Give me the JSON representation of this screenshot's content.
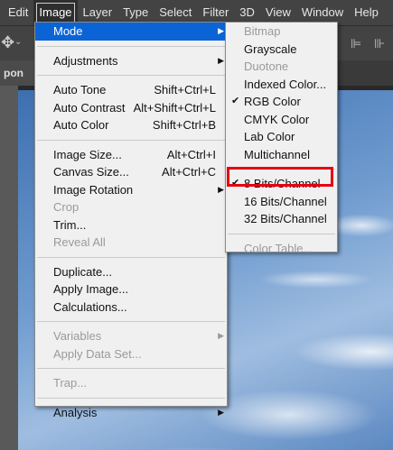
{
  "menubar": {
    "items": [
      "Edit",
      "Image",
      "Layer",
      "Type",
      "Select",
      "Filter",
      "3D",
      "View",
      "Window",
      "Help"
    ],
    "active_index": 1
  },
  "document_tab": {
    "title": "pon"
  },
  "image_menu": {
    "rows": [
      {
        "label": "Mode",
        "shortcut": "",
        "submenu": true,
        "disabled": false,
        "highlight": true
      },
      {
        "sep": true
      },
      {
        "label": "Adjustments",
        "shortcut": "",
        "submenu": true,
        "disabled": false
      },
      {
        "sep": true
      },
      {
        "label": "Auto Tone",
        "shortcut": "Shift+Ctrl+L",
        "disabled": false
      },
      {
        "label": "Auto Contrast",
        "shortcut": "Alt+Shift+Ctrl+L",
        "disabled": false
      },
      {
        "label": "Auto Color",
        "shortcut": "Shift+Ctrl+B",
        "disabled": false
      },
      {
        "sep": true
      },
      {
        "label": "Image Size...",
        "shortcut": "Alt+Ctrl+I",
        "disabled": false
      },
      {
        "label": "Canvas Size...",
        "shortcut": "Alt+Ctrl+C",
        "disabled": false
      },
      {
        "label": "Image Rotation",
        "shortcut": "",
        "submenu": true,
        "disabled": false
      },
      {
        "label": "Crop",
        "shortcut": "",
        "disabled": true
      },
      {
        "label": "Trim...",
        "shortcut": "",
        "disabled": false
      },
      {
        "label": "Reveal All",
        "shortcut": "",
        "disabled": true
      },
      {
        "sep": true
      },
      {
        "label": "Duplicate...",
        "shortcut": "",
        "disabled": false
      },
      {
        "label": "Apply Image...",
        "shortcut": "",
        "disabled": false
      },
      {
        "label": "Calculations...",
        "shortcut": "",
        "disabled": false
      },
      {
        "sep": true
      },
      {
        "label": "Variables",
        "shortcut": "",
        "submenu": true,
        "disabled": true
      },
      {
        "label": "Apply Data Set...",
        "shortcut": "",
        "disabled": true
      },
      {
        "sep": true
      },
      {
        "label": "Trap...",
        "shortcut": "",
        "disabled": true
      },
      {
        "sep": true
      },
      {
        "label": "Analysis",
        "shortcut": "",
        "submenu": true,
        "disabled": false
      }
    ]
  },
  "mode_menu": {
    "rows": [
      {
        "label": "Bitmap",
        "disabled": true,
        "checked": false
      },
      {
        "label": "Grayscale",
        "disabled": false,
        "checked": false
      },
      {
        "label": "Duotone",
        "disabled": true,
        "checked": false
      },
      {
        "label": "Indexed Color...",
        "disabled": false,
        "checked": false
      },
      {
        "label": "RGB Color",
        "disabled": false,
        "checked": true
      },
      {
        "label": "CMYK Color",
        "disabled": false,
        "checked": false
      },
      {
        "label": "Lab Color",
        "disabled": false,
        "checked": false
      },
      {
        "label": "Multichannel",
        "disabled": false,
        "checked": false
      },
      {
        "sep": true
      },
      {
        "label": "8 Bits/Channel",
        "disabled": false,
        "checked": true,
        "annotated": true
      },
      {
        "label": "16 Bits/Channel",
        "disabled": false,
        "checked": false
      },
      {
        "label": "32 Bits/Channel",
        "disabled": false,
        "checked": false
      },
      {
        "sep": true
      },
      {
        "label": "Color Table...",
        "disabled": true,
        "checked": false
      }
    ]
  },
  "icons": {
    "move_tool": "move-tool-icon",
    "submenu_arrow": "chevron-right-icon",
    "check": "checkmark-icon"
  },
  "colors": {
    "highlight": "#0a64d6",
    "annotation_box": "#e60012"
  }
}
